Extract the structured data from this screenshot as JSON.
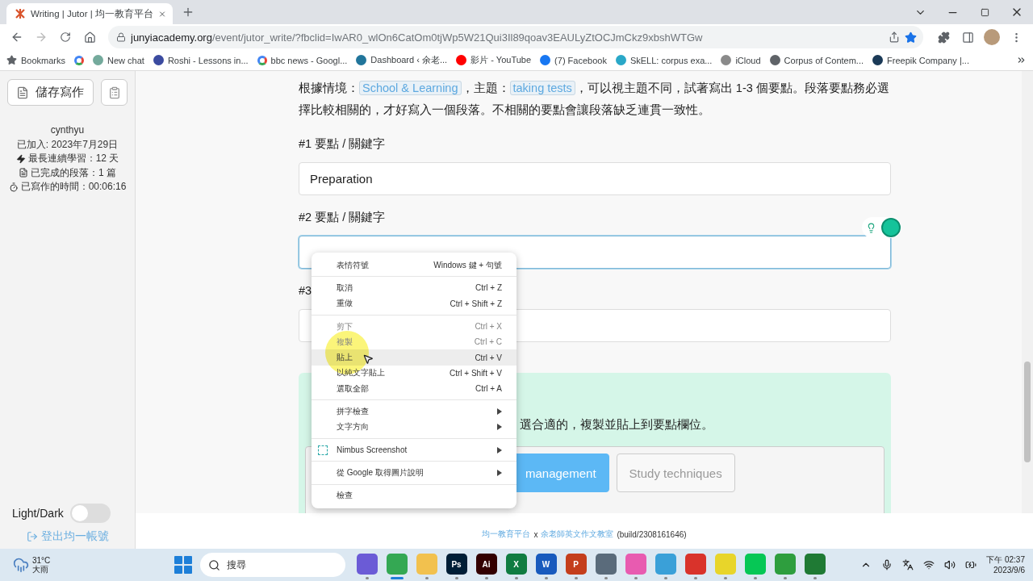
{
  "browser": {
    "tab_title": "Writing | Jutor | 均一教育平台",
    "url_domain": "junyiacademy.org",
    "url_path": "/event/jutor_write/?fbclid=IwAR0_wlOn6CatOm0tjWp5W21Qui3Il89qoav3EAULyZtOCJmCkz9xbshWTGw",
    "bookmarked": true,
    "bookmarks": [
      {
        "kind": "star",
        "label": "Bookmarks"
      },
      {
        "kind": "google"
      },
      {
        "kind": "dot",
        "label": "New chat",
        "color": "#74aa9c"
      },
      {
        "kind": "dot",
        "label": "Roshi - Lessons in...",
        "color": "#3b4ba0"
      },
      {
        "kind": "google",
        "label": "bbc news - Googl..."
      },
      {
        "kind": "dot",
        "label": "Dashboard ‹ 余老...",
        "color": "#21759b"
      },
      {
        "kind": "dot",
        "label": "影片 - YouTube",
        "color": "#ff0000"
      },
      {
        "kind": "dot",
        "label": "(7) Facebook",
        "color": "#1877f2"
      },
      {
        "kind": "dot",
        "label": "SkELL: corpus exa...",
        "color": "#2aa8c8"
      },
      {
        "kind": "dot",
        "label": "iCloud",
        "color": "#8a8a8a"
      },
      {
        "kind": "dot",
        "label": "Corpus of Contem...",
        "color": "#5f6368"
      },
      {
        "kind": "dot",
        "label": "Freepik Company |...",
        "color": "#1b3a57"
      }
    ]
  },
  "sidebar": {
    "save_button": "儲存寫作",
    "username": "cynthyu",
    "joined": "已加入: 2023年7月29日",
    "stats": [
      {
        "kind": "bolt",
        "text": "最長連續學習：12 天"
      },
      {
        "kind": "doc",
        "text": "已完成的段落：1 篇"
      },
      {
        "kind": "timer",
        "text": "已寫作的時間：00:06:16"
      }
    ],
    "theme_toggle": {
      "label": "Light/Dark",
      "on": false
    },
    "logout": "登出均一帳號"
  },
  "main": {
    "instructions": [
      {
        "kind": "text",
        "text": "根據情境："
      },
      {
        "kind": "tag",
        "text": "School & Learning"
      },
      {
        "kind": "text",
        "text": "，主題："
      },
      {
        "kind": "tag",
        "text": "taking tests"
      },
      {
        "kind": "text",
        "text": "，可以視主題不同，試著寫出 1-3 個要點。段落要點務必選擇比較相關的，才好寫入一個段落。不相關的要點會讓段落缺乏連貫一致性。"
      }
    ],
    "fields": [
      {
        "label": "#1 要點 / 關鍵字",
        "value": "Preparation",
        "focused": false
      },
      {
        "label": "#2 要點 / 關鍵字",
        "focused": true
      },
      {
        "label": "#3",
        "focused": false
      }
    ],
    "suggestions": {
      "text_end": "選合適的，複製並貼上到要點欄位。",
      "options": [
        {
          "label": "management",
          "selected": true
        },
        {
          "label": "Study techniques",
          "selected": false
        }
      ]
    }
  },
  "context_menu": [
    {
      "kind": "item",
      "label": "表情符號",
      "shortcut": "Windows 鍵 + 句號",
      "disabled": false,
      "selected": false
    },
    {
      "kind": "separator"
    },
    {
      "kind": "item",
      "label": "取消",
      "shortcut": "Ctrl + Z",
      "disabled": false,
      "selected": false
    },
    {
      "kind": "item",
      "label": "重做",
      "shortcut": "Ctrl + Shift + Z",
      "disabled": false,
      "selected": false
    },
    {
      "kind": "separator"
    },
    {
      "kind": "item",
      "label": "剪下",
      "shortcut": "Ctrl + X",
      "disabled": true,
      "selected": false
    },
    {
      "kind": "item",
      "label": "複製",
      "shortcut": "Ctrl + C",
      "disabled": true,
      "selected": false
    },
    {
      "kind": "item",
      "label": "貼上",
      "shortcut": "Ctrl + V",
      "disabled": false,
      "selected": true
    },
    {
      "kind": "item",
      "label": "以純文字貼上",
      "shortcut": "Ctrl + Shift + V",
      "disabled": false,
      "selected": false
    },
    {
      "kind": "item",
      "label": "選取全部",
      "shortcut": "Ctrl + A",
      "disabled": false,
      "selected": false
    },
    {
      "kind": "separator"
    },
    {
      "kind": "submenu",
      "label": "拼字檢查"
    },
    {
      "kind": "submenu",
      "label": "文字方向"
    },
    {
      "kind": "separator"
    },
    {
      "kind": "submenu",
      "label": "Nimbus Screenshot",
      "icon": true
    },
    {
      "kind": "separator"
    },
    {
      "kind": "submenu",
      "label": "從 Google 取得圖片說明"
    },
    {
      "kind": "separator"
    },
    {
      "kind": "item",
      "label": "檢查",
      "disabled": false,
      "selected": false
    }
  ],
  "footer": {
    "site": "均一教育平台",
    "joiner": "x",
    "partner": "余老師英文作文教室",
    "build": "(build/2308161646)"
  },
  "taskbar": {
    "temperature": "31°C",
    "weather": "大雨",
    "search": "搜尋",
    "time": "下午 02:37",
    "date": "2023/9/6",
    "apps": [
      {
        "color": "#6b5bd6",
        "selected": false
      },
      {
        "color": "#34a853",
        "selected": true
      },
      {
        "color": "#f2c14e",
        "selected": false
      },
      {
        "color": "#001e36",
        "label": "Ps",
        "selected": false
      },
      {
        "color": "#330000",
        "label": "Ai",
        "selected": false
      },
      {
        "color": "#107c41",
        "label": "X",
        "selected": false
      },
      {
        "color": "#185abd",
        "label": "W",
        "selected": false
      },
      {
        "color": "#c43e1c",
        "label": "P",
        "selected": false
      },
      {
        "color": "#5a6b7b",
        "selected": false
      },
      {
        "color": "#e85bb0",
        "selected": false
      },
      {
        "color": "#3aa0d8",
        "selected": false
      },
      {
        "color": "#d9332b",
        "selected": false
      },
      {
        "color": "#e8d52a",
        "selected": false
      },
      {
        "color": "#06c755",
        "selected": false
      },
      {
        "color": "#2e9e3e",
        "selected": false
      },
      {
        "color": "#1f7a34",
        "selected": false
      }
    ]
  }
}
